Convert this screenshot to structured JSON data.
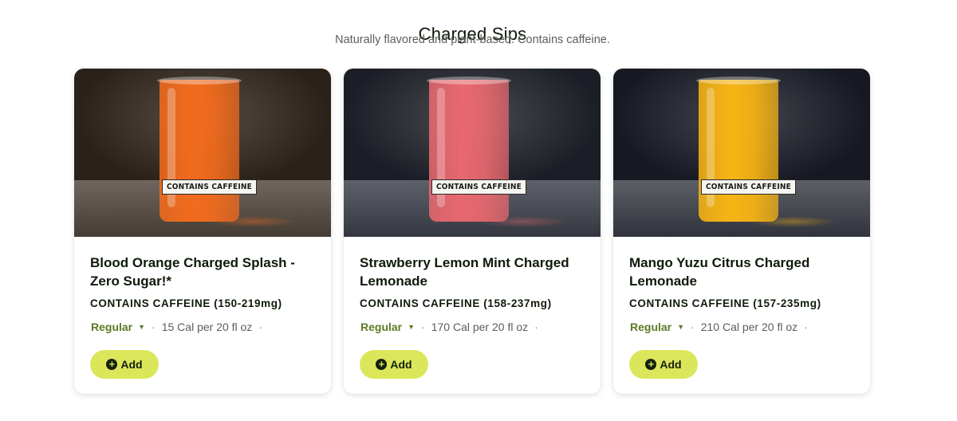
{
  "section": {
    "title": "Charged Sips",
    "subtitle": "Naturally flavored and plant-based. Contains caffeine."
  },
  "cards": [
    {
      "image_tag": "CONTAINS CAFFEINE",
      "name": "Blood Orange Charged Splash - Zero Sugar!*",
      "caffeine": "CONTAINS CAFFEINE (150-219mg)",
      "size": "Regular",
      "calories": "15 Cal per 20 fl oz",
      "add_label": "Add",
      "drink_color": "#f26b1d",
      "wall_color": "#2b2118",
      "table_color": "#6f675f"
    },
    {
      "image_tag": "CONTAINS CAFFEINE",
      "name": "Strawberry Lemon Mint Charged Lemonade",
      "caffeine": "CONTAINS CAFFEINE (158-237mg)",
      "size": "Regular",
      "calories": "170 Cal per 20 fl oz",
      "add_label": "Add",
      "drink_color": "#e8686f",
      "wall_color": "#1b1e26",
      "table_color": "#5e6169"
    },
    {
      "image_tag": "CONTAINS CAFFEINE",
      "name": "Mango Yuzu Citrus Charged Lemonade",
      "caffeine": "CONTAINS CAFFEINE (157-235mg)",
      "size": "Regular",
      "calories": "210 Cal per 20 fl oz",
      "add_label": "Add",
      "drink_color": "#f7b414",
      "wall_color": "#161922",
      "table_color": "#5c5f66"
    }
  ],
  "icons": {
    "size_dropdown": "caret-down-icon",
    "add": "plus-circle-icon"
  },
  "colors": {
    "add_button": "#dce65a",
    "size_text": "#5d7a26",
    "heading": "#0e1a0a"
  }
}
